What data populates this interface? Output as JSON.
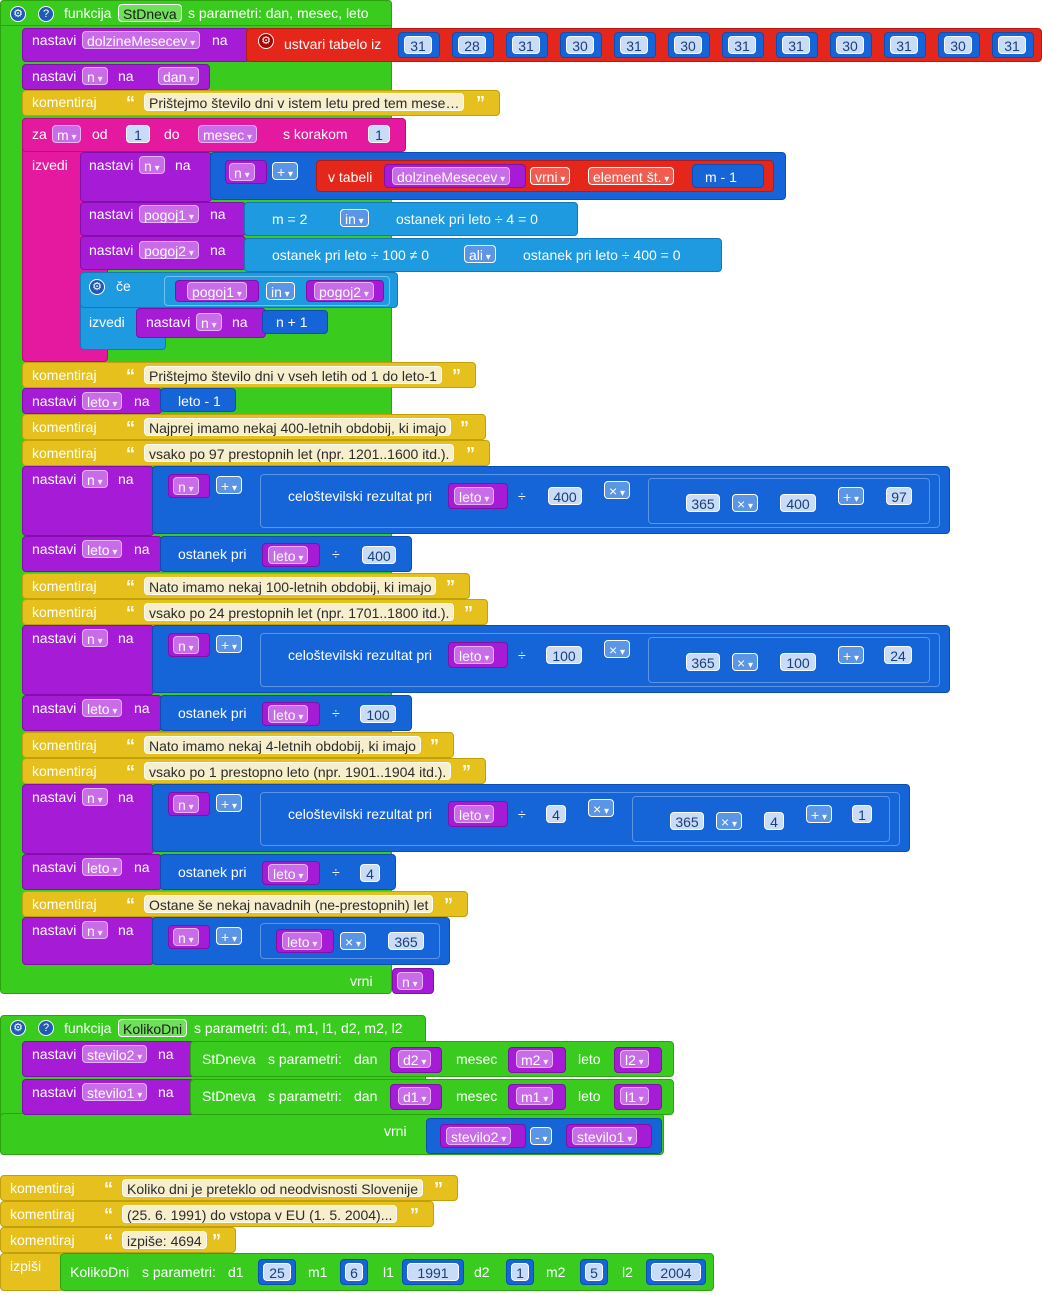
{
  "func1": {
    "keyword": "funkcija",
    "name": "StDneva",
    "params_label": "s parametri: dan, mesec, leto",
    "gear_icon": "gear-icon",
    "help_icon": "help-icon"
  },
  "common": {
    "nastavi": "nastavi",
    "na": "na",
    "komentiraj": "komentiraj",
    "izvedi": "izvedi",
    "vrni": "vrni",
    "ce": "če",
    "ostanek": "ostanek pri",
    "celo": "celoštevilski rezultat pri",
    "div": "÷",
    "times": "×",
    "plus": "+",
    "minus": "-",
    "in": "in",
    "ali": "ali",
    "izpisi": "izpiši",
    "sparam": "s parametri:"
  },
  "b1": {
    "var": "dolzineMesecev",
    "create": "ustvari tabelo iz",
    "values": [
      "31",
      "28",
      "31",
      "30",
      "31",
      "30",
      "31",
      "31",
      "30",
      "31",
      "30",
      "31"
    ]
  },
  "b2": {
    "var": "n",
    "val": "dan"
  },
  "c1": "Prištejmo število dni v istem letu pred tem mese…",
  "loop": {
    "za": "za",
    "var": "m",
    "od": "od",
    "from": "1",
    "do": "do",
    "to": "mesec",
    "step_label": "s korakom",
    "step": "1"
  },
  "l1": {
    "var": "n",
    "n": "n",
    "tab": "v tabeli",
    "arr": "dolzineMesecev",
    "vrni": "vrni",
    "elem": "element št.",
    "idx": "m - 1"
  },
  "l2": {
    "var": "pogoj1",
    "a": "m = 2",
    "b": "ostanek pri leto ÷ 4 = 0"
  },
  "l3": {
    "var": "pogoj2",
    "a": "ostanek pri leto ÷ 100 ≠ 0",
    "b": "ostanek pri leto ÷ 400 = 0"
  },
  "l4": {
    "a": "pogoj1",
    "b": "pogoj2",
    "var": "n",
    "val": "n + 1"
  },
  "c2": "Prištejmo število dni v vseh letih od 1 do leto-1",
  "b3": {
    "var": "leto",
    "val": "leto - 1"
  },
  "c3": "Najprej imamo nekaj 400-letnih obdobij, ki imajo",
  "c4": "vsako po 97 prestopnih let (npr. 1201..1600 itd.).",
  "s400": {
    "var": "n",
    "n": "n",
    "leto": "leto",
    "d": "400",
    "m": "365",
    "m2": "400",
    "add": "97"
  },
  "o400": {
    "var": "leto",
    "leto": "leto",
    "d": "400"
  },
  "c5": "Nato imamo nekaj 100-letnih obdobij, ki imajo",
  "c6": "vsako po 24 prestopnih let (npr. 1701..1800 itd.).",
  "s100": {
    "var": "n",
    "n": "n",
    "leto": "leto",
    "d": "100",
    "m": "365",
    "m2": "100",
    "add": "24"
  },
  "o100": {
    "var": "leto",
    "leto": "leto",
    "d": "100"
  },
  "c7": "Nato imamo nekaj 4-letnih obdobij, ki imajo",
  "c8": "vsako po 1 prestopno leto (npr. 1901..1904 itd.).",
  "s4": {
    "var": "n",
    "n": "n",
    "leto": "leto",
    "d": "4",
    "m": "365",
    "m2": "4",
    "add": "1"
  },
  "o4": {
    "var": "leto",
    "leto": "leto",
    "d": "4"
  },
  "c9": "Ostane še nekaj navadnih (ne-prestopnih) let",
  "s1": {
    "var": "n",
    "n": "n",
    "leto": "leto",
    "m": "365"
  },
  "ret1": {
    "val": "n"
  },
  "func2": {
    "keyword": "funkcija",
    "name": "KolikoDni",
    "params_label": "s parametri: d1, m1, l1, d2, m2, l2"
  },
  "f2a": {
    "var": "stevilo2",
    "fn": "StDneva",
    "dan": "dan",
    "dv": "d2",
    "mesec": "mesec",
    "mv": "m2",
    "leto": "leto",
    "lv": "l2"
  },
  "f2b": {
    "var": "stevilo1",
    "fn": "StDneva",
    "dan": "dan",
    "dv": "d1",
    "mesec": "mesec",
    "mv": "m1",
    "leto": "leto",
    "lv": "l1"
  },
  "ret2": {
    "a": "stevilo2",
    "b": "stevilo1"
  },
  "c10": "Koliko dni je preteklo od neodvisnosti Slovenije",
  "c11": "(25. 6. 1991) do vstopa v EU (1. 5. 2004)...",
  "c12": "izpiše: 4694",
  "call": {
    "fn": "KolikoDni",
    "labels": [
      "d1",
      "m1",
      "l1",
      "d2",
      "m2",
      "l2"
    ],
    "values": [
      "25",
      "6",
      "1991",
      "1",
      "5",
      "2004"
    ]
  }
}
